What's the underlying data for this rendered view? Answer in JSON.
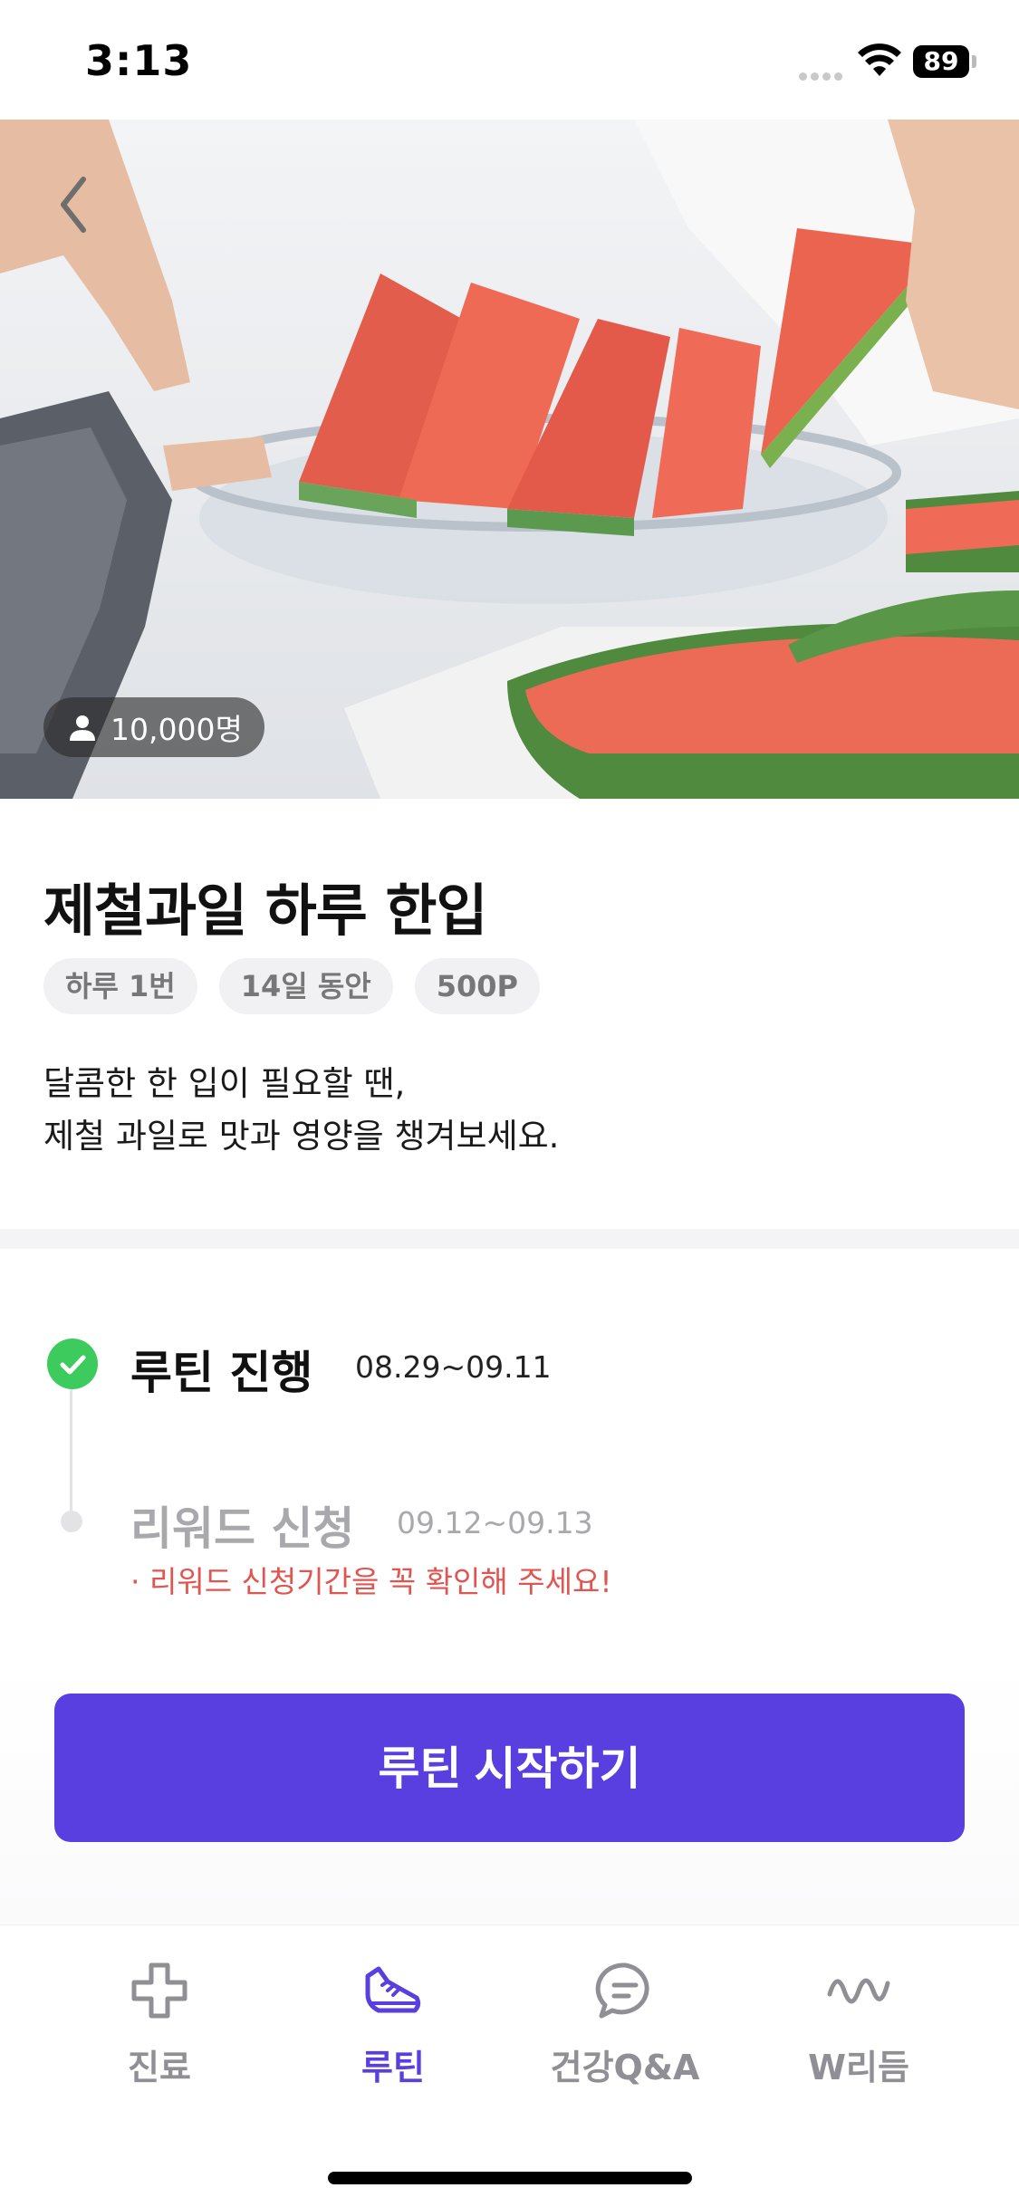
{
  "status_bar": {
    "time": "3:13",
    "battery": "89"
  },
  "hero": {
    "participants": "10,000명"
  },
  "routine": {
    "title": "제철과일 하루 한입",
    "tags": [
      "하루 1번",
      "14일 동안",
      "500P"
    ],
    "description_line1": "달콤한 한 입이 필요할 땐,",
    "description_line2": "제철 과일로 맛과 영양을 챙겨보세요."
  },
  "timeline": {
    "step1": {
      "label": "루틴 진행",
      "date": "08.29~09.11"
    },
    "step2": {
      "label": "리워드 신청",
      "date": "09.12~09.13",
      "note": "· 리워드 신청기간을 꼭 확인해 주세요!"
    }
  },
  "cta": {
    "label": "루틴 시작하기"
  },
  "tabbar": {
    "tabs": [
      {
        "label": "진료",
        "icon": "cross-icon"
      },
      {
        "label": "루틴",
        "icon": "sneaker-icon",
        "active": true
      },
      {
        "label": "건강Q&A",
        "icon": "chat-bubble-icon"
      },
      {
        "label": "W리듬",
        "icon": "wave-icon"
      }
    ]
  },
  "colors": {
    "accent": "#5a3fe0",
    "check": "#3ecb5e",
    "warning": "#e2544f"
  }
}
